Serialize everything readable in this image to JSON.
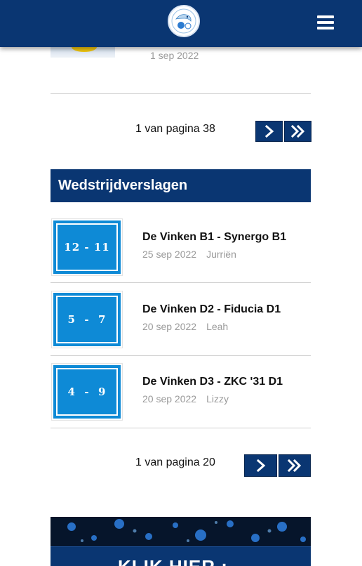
{
  "header": {
    "logo_icon": "club-logo-icon",
    "menu_icon": "hamburger-menu-icon"
  },
  "news_list": {
    "last_item_date": "1 sep 2022",
    "pagination": {
      "text": "1 van pagina 38",
      "next_icon": "chevron-right-icon",
      "last_icon": "double-chevron-right-icon"
    }
  },
  "match_reports": {
    "title": "Wedstrijdverslagen",
    "items": [
      {
        "score": "12 - 11",
        "title": "De Vinken B1 - Synergo B1",
        "date": "25 sep 2022",
        "author": "Jurriën"
      },
      {
        "score": "5  -  7",
        "title": "De Vinken D2 - Fiducia D1",
        "date": "20 sep 2022",
        "author": "Leah"
      },
      {
        "score": "4  -  9",
        "title": "De Vinken D3 - ZKC '31 D1",
        "date": "20 sep 2022",
        "author": "Lizzy"
      }
    ],
    "pagination": {
      "text": "1 van pagina 20",
      "next_icon": "chevron-right-icon",
      "last_icon": "double-chevron-right-icon"
    }
  },
  "banner": {
    "text": "KLIK HIER :",
    "image_icon": "virus-image"
  },
  "colors": {
    "primary": "#0a3672",
    "score_blue": "#0e8ad6",
    "muted_text": "#9a9a9a"
  }
}
